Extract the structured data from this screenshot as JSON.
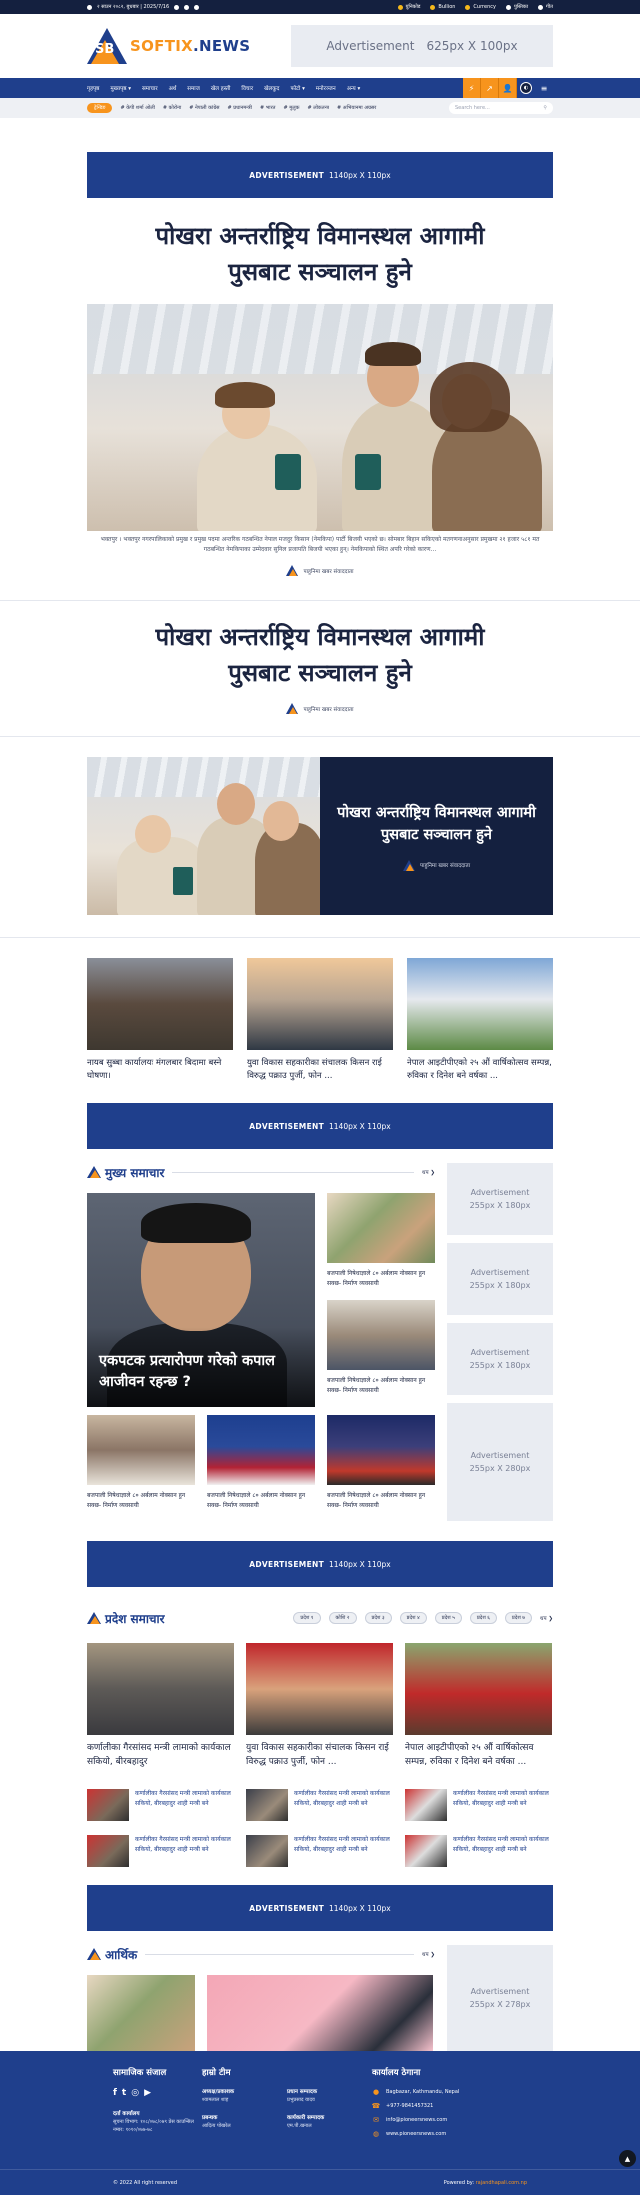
{
  "topbar": {
    "date": "२ साउन २०८२, बुधबार | 2025/7/16",
    "links": [
      "युनिकोड",
      "Bullion",
      "Currency",
      "पुस्तिका",
      "गीत"
    ]
  },
  "header": {
    "logo_sb": "SB",
    "logo_softix": "SOFTIX",
    "logo_news": ".NEWS",
    "ad_label": "Advertisement",
    "ad_size": "625px X 100px"
  },
  "nav": {
    "items": [
      "गृहपृष्ठ",
      "मुख्यपृष्ठ ▾",
      "समाचार",
      "अर्थ",
      "समाज",
      "खेल हस्ती",
      "विचार",
      "खेलकुद",
      "फोटो ▾",
      "मनोरञ्जन",
      "अन्य ▾"
    ],
    "tools": [
      "⚡",
      "↗",
      "👤",
      "◐",
      "≡"
    ]
  },
  "trending": {
    "badge": "ट्रेन्डिङ",
    "tags": [
      "# केपी शर्मा ओली",
      "# कोरोना",
      "# नेपाली कांग्रेस",
      "# प्रधानमन्त्री",
      "# भारत",
      "# मुलुक",
      "# लोकतन्त्र",
      "# अभियानमा अग्रसर"
    ],
    "search_placeholder": "Search here..."
  },
  "ad_banner": {
    "label": "ADVERTISEMENT",
    "size": "1140px X 110px"
  },
  "hero": {
    "headline": "पोखरा अन्तर्राष्ट्रिय विमानस्थल आगामी पुसबाट सञ्चालन हुने",
    "caption": "भक्तपुर । भक्तपुर नगरपालिकाको प्रमुख र प्रमुख पदमा अन्तरिक गठबन्धित नेपाल मजदुर किसान (नेमकिपा) पार्टी बिजयी भएको छ। सोमबार बिहान सकिएको मतगणनाअनुसार प्रमुखमा २१ हजार ५८१ मत गठबन्धित नेमकिपाका उम्मेदवार सुनिल प्रजापति बिजयी भएका हुन्। नेमकिपाको स्थित अपरि गरेको कारण...",
    "author": "पाहुनिमा खबर संवाददाता"
  },
  "headline2": {
    "text": "पोखरा अन्तर्राष्ट्रिय विमानस्थल आगामी पुसबाट सञ्चालन हुने",
    "author": "पाहुनिमा खबर संवाददाता"
  },
  "feature": {
    "title": "पोखरा अन्तर्राष्ट्रिय विमानस्थल आगामी पुसबाट सञ्चालन हुने",
    "author": "पाहुनिमा खबर संवाददाता"
  },
  "three_cards": [
    {
      "title": "नायब सुब्बा कार्यालयः मंगलबार बिदामा बस्ने घोषणा।"
    },
    {
      "title": "युवा विकास सहकारीका संचालक किसन राई विरुद्ध पक्राउ पुर्जी, फोन ..."
    },
    {
      "title": "नेपाल आइटीपीएकाे २५ औं वार्षिकोत्सव सम्पन्न, रुविका र दिनेश बने वर्षका ..."
    }
  ],
  "main_news": {
    "title": "मुख्य समाचार",
    "more": "थप ❯",
    "big_title": "एकपटक प्रत्यारोपण गरेको कपाल आजीवन रहन्छ ?",
    "side_items": [
      {
        "title": "बजपाली निषेधाज्ञाले ८० अर्बलाम नोक्सान हुन सक्छ- निर्माण व्यवसायी"
      },
      {
        "title": "बजपाली निषेधाज्ञाले ८० अर्बलाम नोक्सान हुन सक्छ- निर्माण व्यवसायी"
      }
    ],
    "bottom_items": [
      {
        "title": "बजपाली निषेधाज्ञाले ८० अर्बलाम नोक्सान हुन सक्छ- निर्माण व्यवसायी"
      },
      {
        "title": "बजपाली निषेधाज्ञाले ८० अर्बलाम नोक्सान हुन सक्छ- निर्माण व्यवसायी"
      },
      {
        "title": "बजपाली निषेधाज्ञाले ८० अर्बलाम नोक्सान हुन सक्छ- निर्माण व्यवसायी"
      }
    ],
    "ads": [
      {
        "label": "Advertisement",
        "size": "255px X 180px"
      },
      {
        "label": "Advertisement",
        "size": "255px X 180px"
      },
      {
        "label": "Advertisement",
        "size": "255px X 180px"
      },
      {
        "label": "Advertisement",
        "size": "255px X 280px"
      }
    ]
  },
  "province": {
    "title": "प्रदेश समाचार",
    "pills": [
      "प्रदेश १",
      "कोशि २",
      "प्रदेश ३",
      "प्रदेश ४",
      "प्रदेश ५",
      "प्रदेश ६",
      "प्रदेश ७"
    ],
    "more": "थप ❯",
    "cards": [
      {
        "title": "कर्णालीका गैरसांसद मन्त्री लामाको कार्यकाल सकियो, बीरबहादुर"
      },
      {
        "title": "युवा विकास सहकारीका संचालक किसन राई विरुद्ध पक्राउ पुर्जी, फोन ..."
      },
      {
        "title": "नेपाल आइटीपीएकाे २५ औं वार्षिकोत्सव सम्पन्न, रुविका र दिनेश बने वर्षका ..."
      }
    ],
    "mini_title": "कर्णालीका गैरसांसद मन्त्री लामाको कार्यकाल सकियो, बीरबहादुर शाही मन्त्री बने"
  },
  "economy": {
    "title": "आर्थिक",
    "more": "थप ❯",
    "ad_label": "Advertisement",
    "ad_size": "255px X 278px"
  },
  "footer": {
    "social_title": "सामाजिक संजाल",
    "office_label": "दर्ता कार्यालय",
    "office_text": "सूचना विभाग: १०८/०७८/०७९ प्रेस काउन्सिल नम्बर: १०१०/०७७-७८",
    "team_title": "हाम्रो टीम",
    "team": [
      {
        "role": "अध्यक्ष/प्रकाशक",
        "name": "श्यामलाल शाह"
      },
      {
        "role": "प्रधान सम्पादक",
        "name": "प्रभुप्रसाद यादव"
      },
      {
        "role": "प्रबन्धक",
        "name": "आदित्य पोखरेल"
      },
      {
        "role": "कार्यकारी सम्पादक",
        "name": "एम.पी.खनाल"
      }
    ],
    "contact_title": "कार्यालय ठेगाना",
    "contacts": [
      "Bagbazar, Kathmandu, Nepal",
      "+977-9841457321",
      "info@pioneersnews.com",
      "www.pioneersnews.com"
    ],
    "copyright": "© 2022 All right reserved",
    "powered_by": "Powered by: ",
    "powered_by_link": "rajandhapali.com.np"
  }
}
